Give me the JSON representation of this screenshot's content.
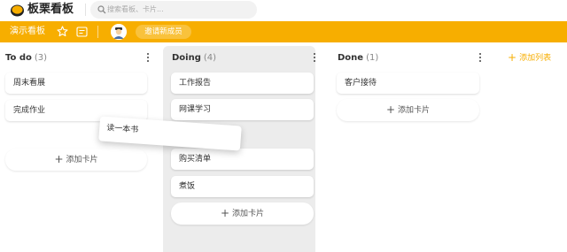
{
  "header": {
    "app_name": "板栗看板",
    "search_placeholder": "搜索看板、卡片..."
  },
  "board": {
    "title": "演示看板",
    "invite_label": "邀请新成员"
  },
  "columns": [
    {
      "name": "To do",
      "count": "(3)",
      "cards": [
        "周末看展",
        "完成作业"
      ],
      "add_label": "添加卡片"
    },
    {
      "name": "Doing",
      "count": "(4)",
      "cards": [
        "工作报告",
        "网课学习",
        "购买清单",
        "煮饭"
      ],
      "add_label": "添加卡片"
    },
    {
      "name": "Done",
      "count": "(1)",
      "cards": [
        "客户接待"
      ],
      "add_label": "添加卡片"
    }
  ],
  "dragging_card": "读一本书",
  "add_list_label": "添加列表",
  "colors": {
    "accent": "#f7ae00",
    "column_bg": "#ececec"
  }
}
